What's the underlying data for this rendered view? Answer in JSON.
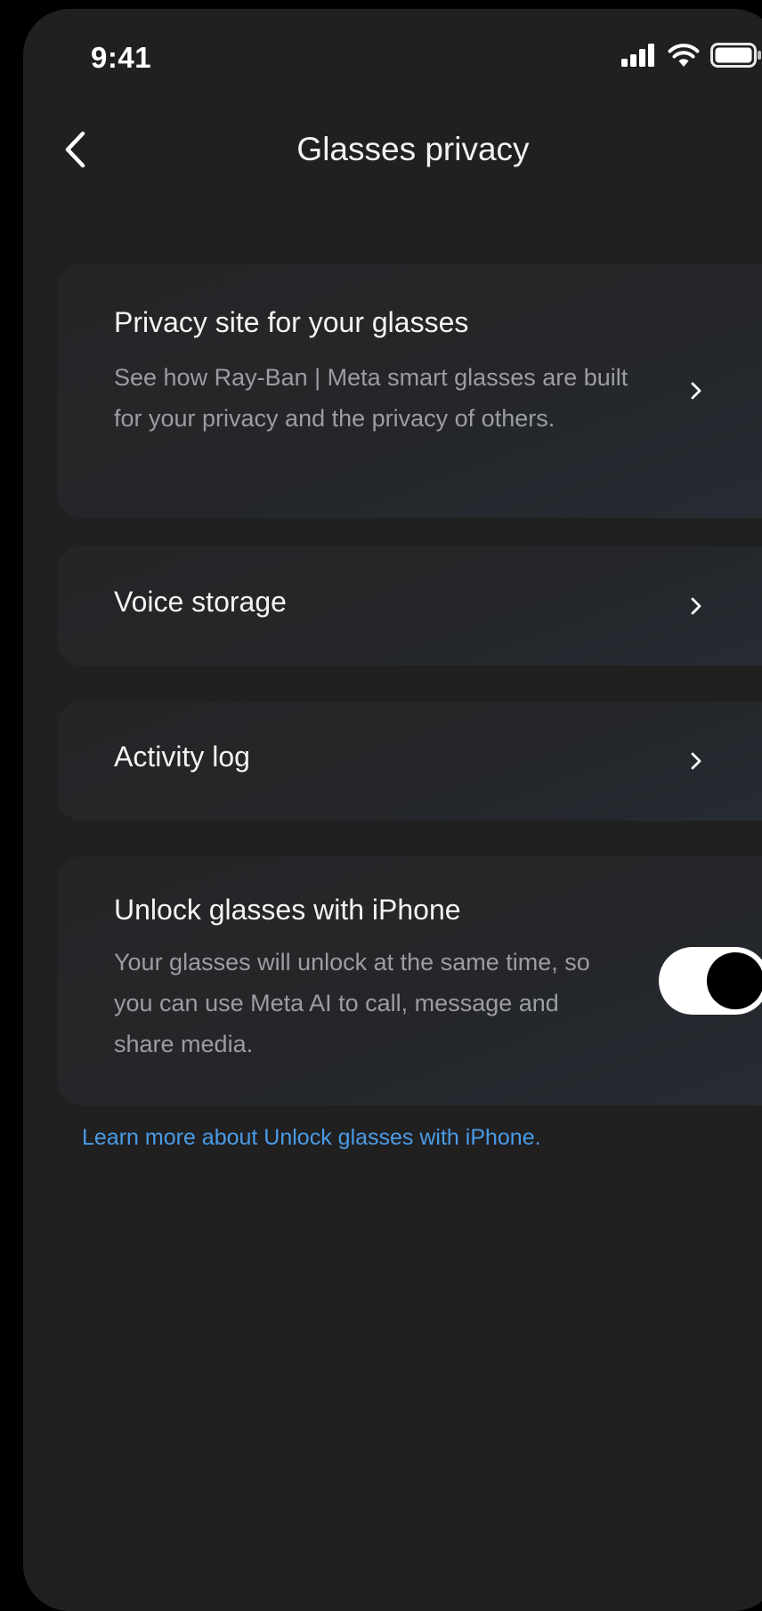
{
  "status_bar": {
    "time": "9:41",
    "signal_icon": "cellular-signal-icon",
    "wifi_icon": "wifi-icon",
    "battery_icon": "battery-icon"
  },
  "header": {
    "back_icon": "chevron-left-icon",
    "title": "Glasses privacy"
  },
  "items": {
    "privacy_site": {
      "title": "Privacy site for your glasses",
      "description": "See how Ray-Ban | Meta smart glasses are built for your privacy and the privacy of others.",
      "icon": "chevron-right-icon"
    },
    "voice_storage": {
      "title": "Voice storage",
      "icon": "chevron-right-icon"
    },
    "activity_log": {
      "title": "Activity log",
      "icon": "chevron-right-icon"
    },
    "unlock_iphone": {
      "title": "Unlock glasses with iPhone",
      "description": "Your glasses will unlock at the same time, so you can use Meta AI to call, message and share media.",
      "toggle_on": true
    }
  },
  "learn_more_link": "Learn more about Unlock glasses with iPhone.",
  "colors": {
    "background": "#202021",
    "card": "#252527",
    "link": "#4a9be6",
    "secondary_text": "#9c9da1"
  }
}
